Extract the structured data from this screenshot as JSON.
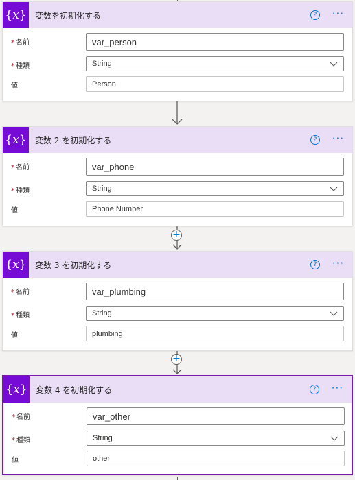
{
  "icons": {
    "variable": "curly-braces-x-icon",
    "help": "question-circle-icon",
    "more": "ellipsis-icon",
    "chevron": "chevron-down-icon",
    "arrow": "arrow-down-icon",
    "plus": "plus-circle-icon"
  },
  "colors": {
    "accent": "#770bd6",
    "header_bg": "#eadef7",
    "selected_border": "#7719aa",
    "link_blue": "#0078d4",
    "required": "#a4262c"
  },
  "labels": {
    "name": "名前",
    "type": "種類",
    "value": "値",
    "required_mark": "*",
    "help_glyph": "?",
    "more_glyph": "···",
    "plus_glyph": "+",
    "icon_open": "{",
    "icon_var": "x",
    "icon_close": "}"
  },
  "actions": [
    {
      "title": "変数を初期化する",
      "name_value": "var_person",
      "type_value": "String",
      "value_value": "Person",
      "selected": false
    },
    {
      "title": "変数 2 を初期化する",
      "name_value": "var_phone",
      "type_value": "String",
      "value_value": "Phone Number",
      "selected": false
    },
    {
      "title": "変数 3 を初期化する",
      "name_value": "var_plumbing",
      "type_value": "String",
      "value_value": "plumbing",
      "selected": false
    },
    {
      "title": "変数 4 を初期化する",
      "name_value": "var_other",
      "type_value": "String",
      "value_value": "other",
      "selected": true
    }
  ]
}
